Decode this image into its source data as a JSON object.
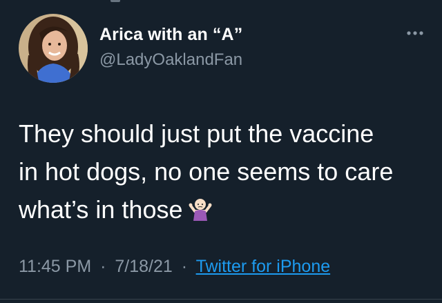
{
  "tweet": {
    "author": {
      "display_name": "Arica with an “A”",
      "handle": "@LadyOaklandFan",
      "avatar_icon": "profile-photo"
    },
    "more_icon": "more-options-icon",
    "text_lines": [
      "They should just put the vaccine",
      "in hot dogs, no one seems to care",
      "what’s in those"
    ],
    "emoji": "person-shrugging-emoji",
    "time": "11:45 PM",
    "separator": "·",
    "date": "7/18/21",
    "source": "Twitter for iPhone"
  },
  "colors": {
    "background": "#15202b",
    "text": "#ffffff",
    "secondary": "#8b98a5",
    "link": "#1d9bf0"
  }
}
